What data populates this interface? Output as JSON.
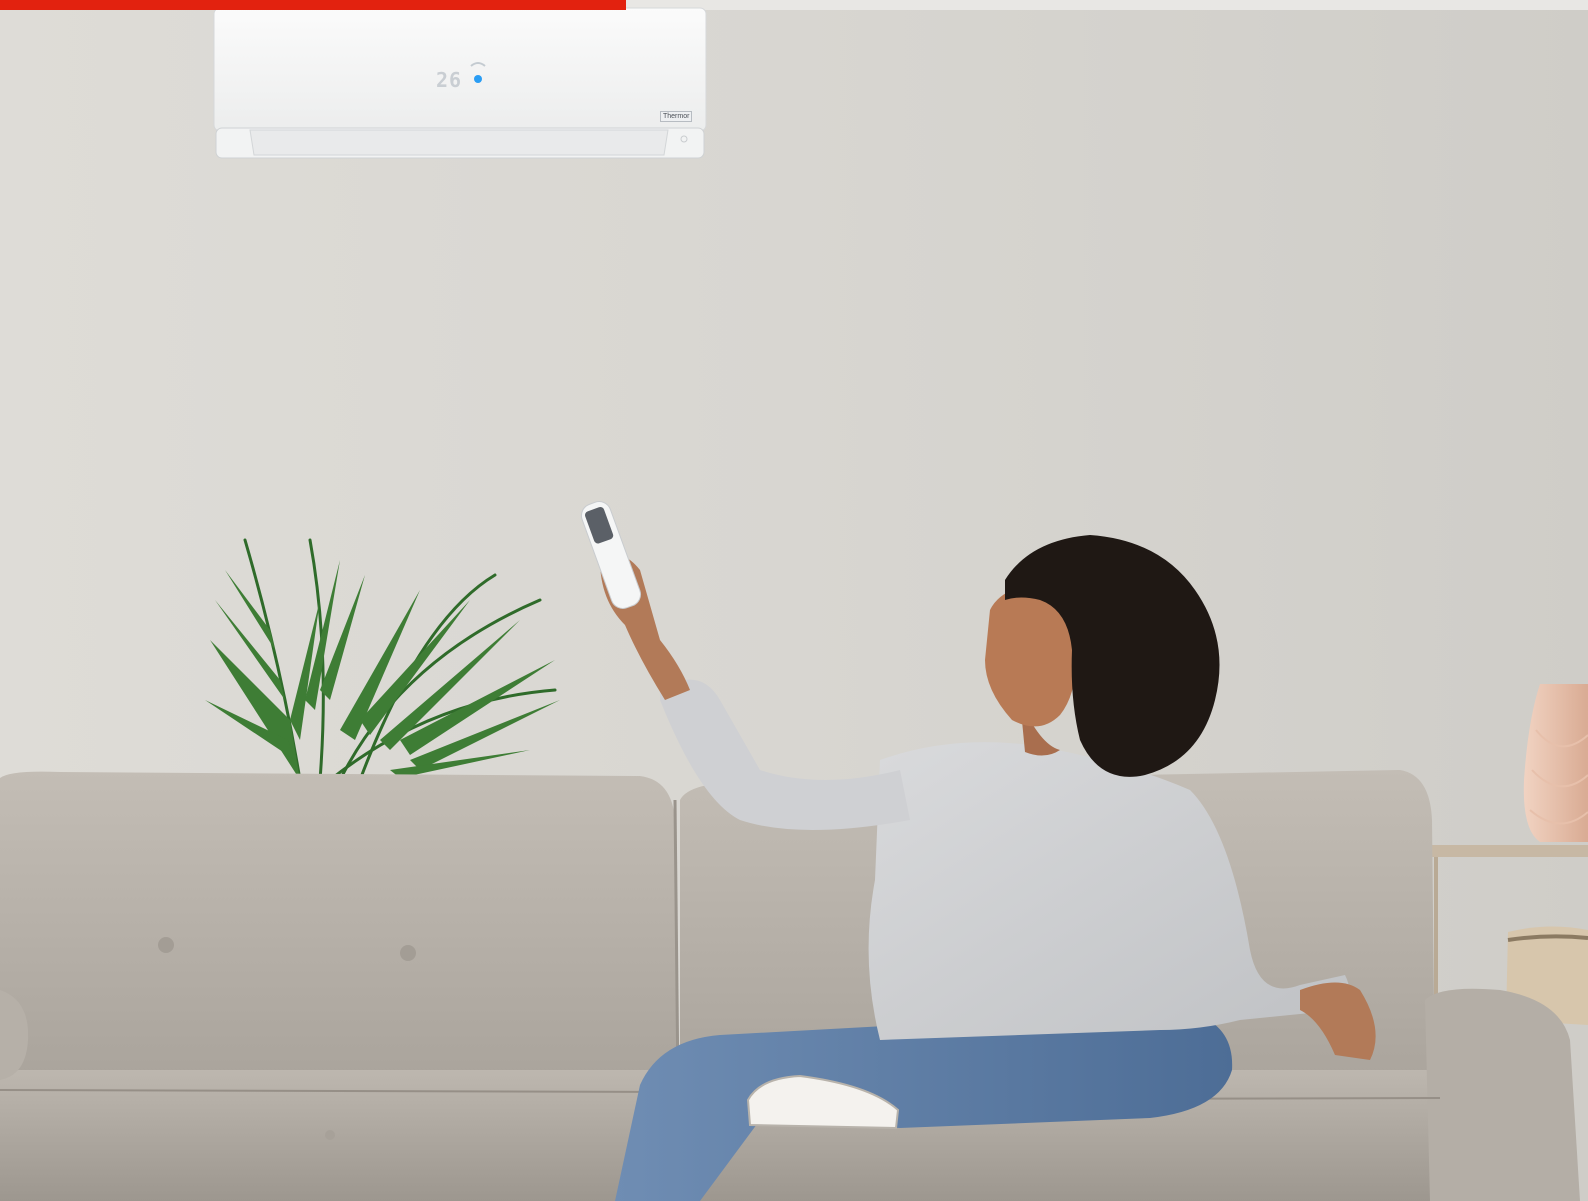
{
  "accent_color": "#e2220f",
  "air_conditioner": {
    "display_temperature": "26",
    "brand_label": "Thermor"
  }
}
